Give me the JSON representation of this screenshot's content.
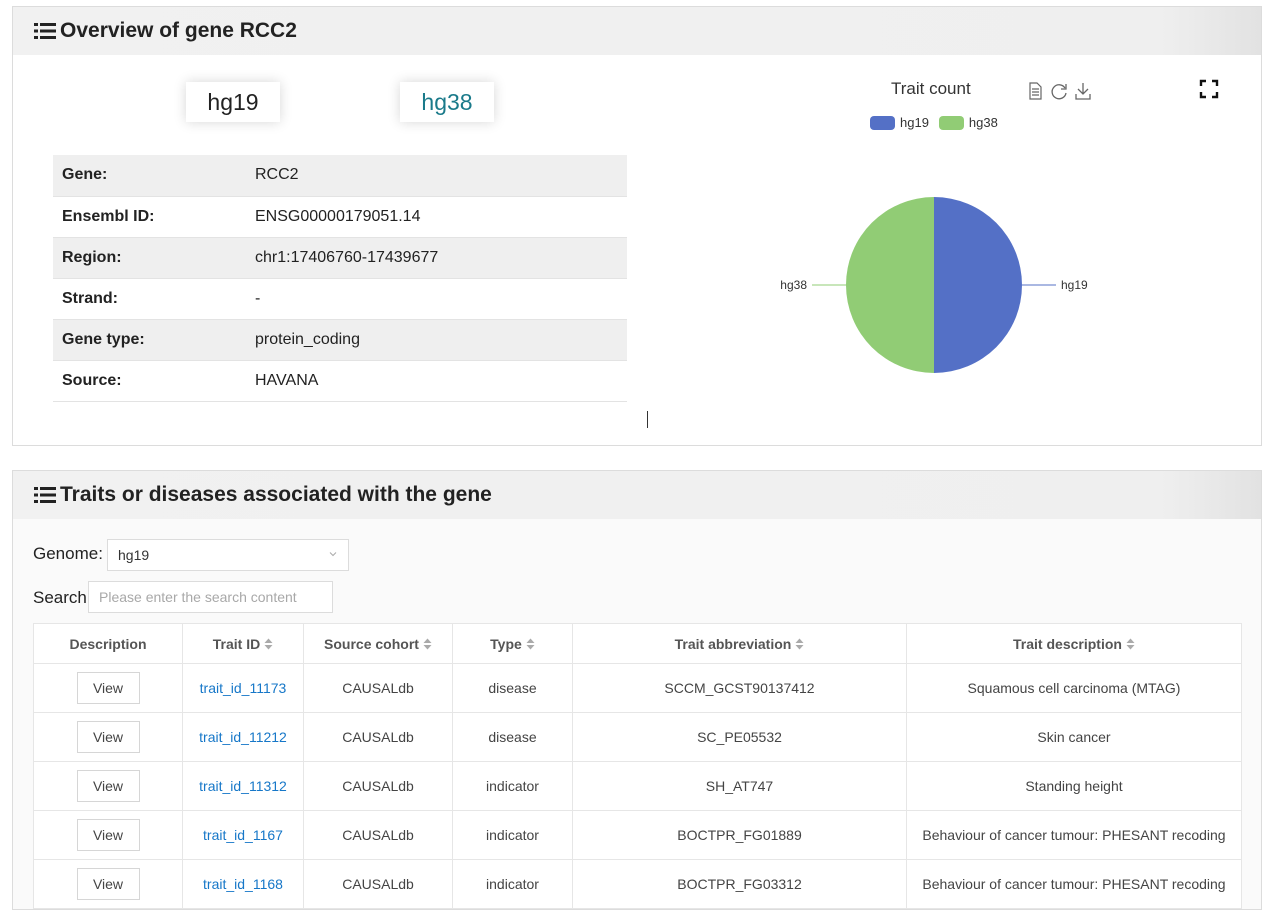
{
  "overview": {
    "title": "Overview of gene RCC2",
    "tabs": [
      "hg19",
      "hg38"
    ],
    "rows": [
      {
        "label": "Gene:",
        "value": "RCC2"
      },
      {
        "label": "Ensembl ID:",
        "value": "ENSG00000179051.14"
      },
      {
        "label": "Region:",
        "value": "chr1:17406760-17439677"
      },
      {
        "label": "Strand:",
        "value": "-"
      },
      {
        "label": "Gene type:",
        "value": "protein_coding"
      },
      {
        "label": "Source:",
        "value": "HAVANA"
      }
    ]
  },
  "chart_data": {
    "type": "pie",
    "title": "Trait count",
    "legend_position": "top",
    "labels": [
      "hg19",
      "hg38"
    ],
    "values": [
      1,
      1
    ],
    "colors": [
      "#5470c6",
      "#91cc75"
    ]
  },
  "traits": {
    "title": "Traits or diseases associated with the gene",
    "genome_label": "Genome:",
    "genome_value": "hg19",
    "search_label": "Search:",
    "search_placeholder": "Please enter the search content",
    "columns": [
      "Description",
      "Trait ID",
      "Source cohort",
      "Type",
      "Trait abbreviation",
      "Trait description"
    ],
    "view_label": "View",
    "rows": [
      {
        "id": "trait_id_11173",
        "cohort": "CAUSALdb",
        "type": "disease",
        "abbr": "SCCM_GCST90137412",
        "desc": "Squamous cell carcinoma (MTAG)"
      },
      {
        "id": "trait_id_11212",
        "cohort": "CAUSALdb",
        "type": "disease",
        "abbr": "SC_PE05532",
        "desc": "Skin cancer"
      },
      {
        "id": "trait_id_11312",
        "cohort": "CAUSALdb",
        "type": "indicator",
        "abbr": "SH_AT747",
        "desc": "Standing height"
      },
      {
        "id": "trait_id_1167",
        "cohort": "CAUSALdb",
        "type": "indicator",
        "abbr": "BOCTPR_FG01889",
        "desc": "Behaviour of cancer tumour: PHESANT recoding"
      },
      {
        "id": "trait_id_1168",
        "cohort": "CAUSALdb",
        "type": "indicator",
        "abbr": "BOCTPR_FG03312",
        "desc": "Behaviour of cancer tumour: PHESANT recoding"
      }
    ]
  },
  "icons": [
    "list-icon",
    "data-view-icon",
    "restore-icon",
    "save-image-icon",
    "fullscreen-icon",
    "sort-icon",
    "chevron-down-icon"
  ]
}
